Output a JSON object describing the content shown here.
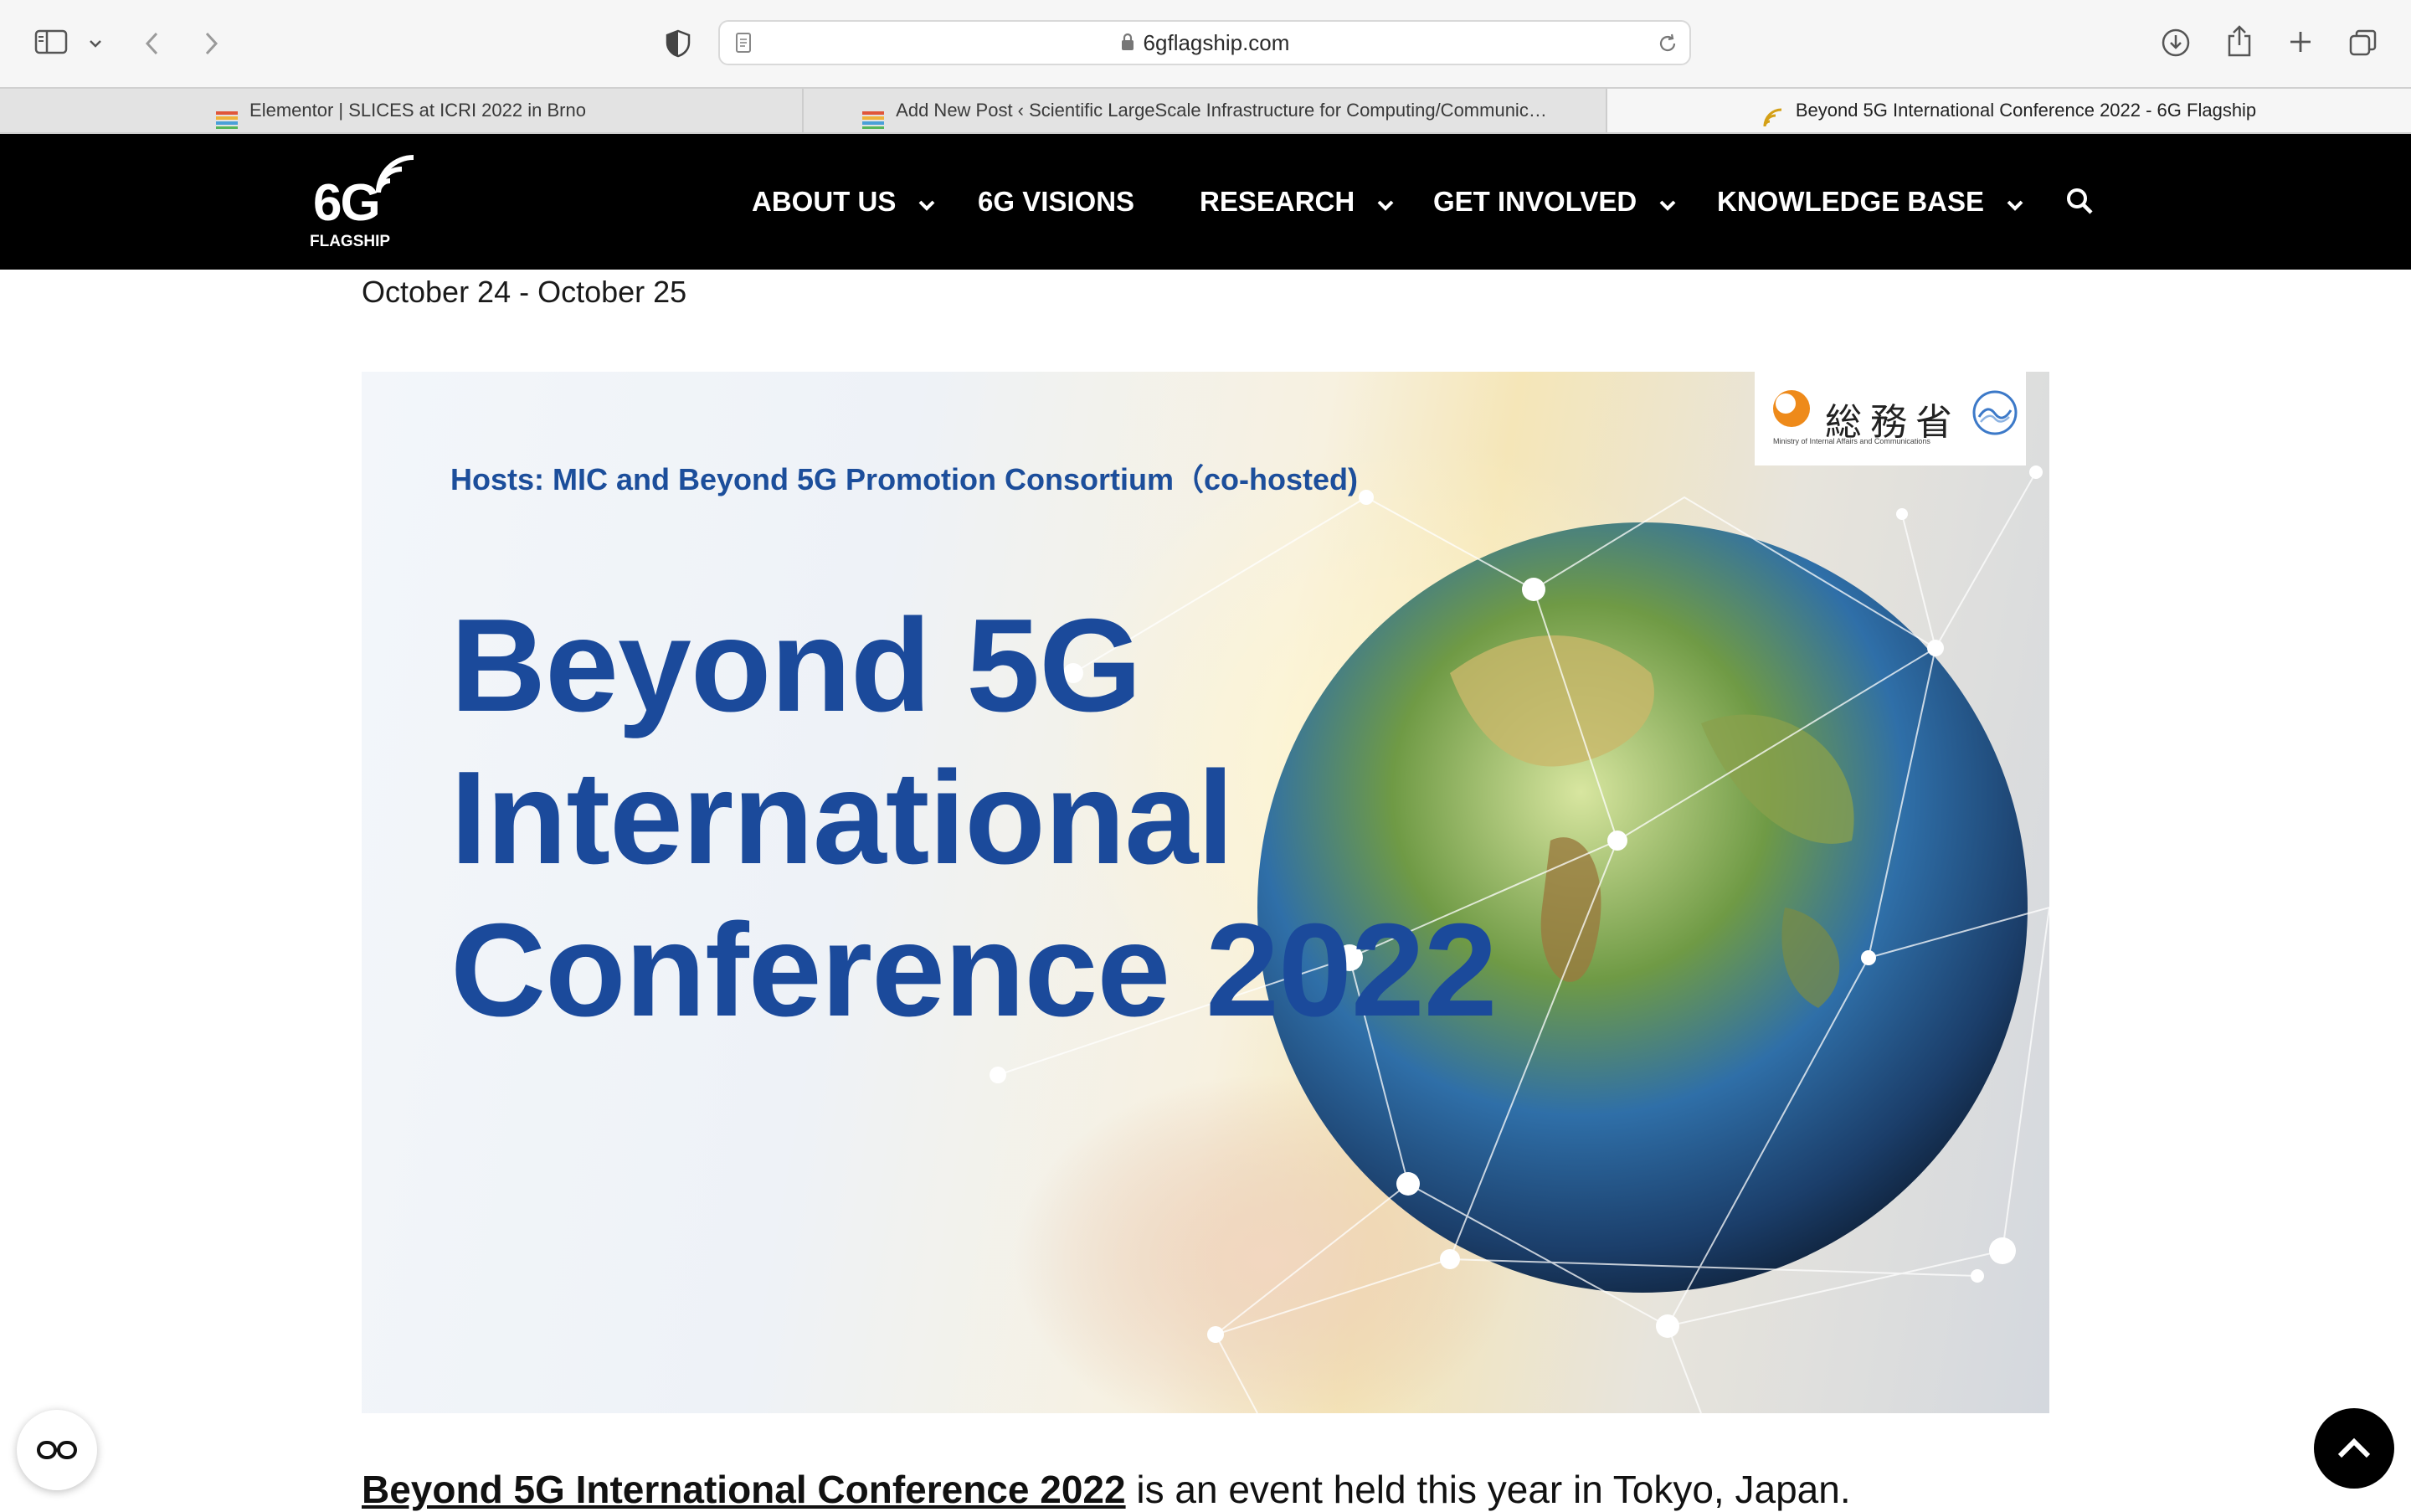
{
  "browser": {
    "url": "6gflagship.com",
    "tabs": [
      {
        "label": "Elementor | SLICES at ICRI 2022 in Brno",
        "active": false,
        "icon": "elementor-favicon"
      },
      {
        "label": "Add New Post ‹ Scientific LargeScale Infrastructure for Computing/Communic…",
        "active": false,
        "icon": "elementor-favicon"
      },
      {
        "label": "Beyond 5G International Conference 2022 - 6G Flagship",
        "active": true,
        "icon": "6g-flagship-favicon"
      }
    ]
  },
  "site": {
    "logo_main": "6G",
    "logo_sub": "FLAGSHIP",
    "nav": [
      {
        "label": "ABOUT US",
        "has_dropdown": true
      },
      {
        "label": "6G VISIONS",
        "has_dropdown": false
      },
      {
        "label": "RESEARCH",
        "has_dropdown": true
      },
      {
        "label": "GET INVOLVED",
        "has_dropdown": true
      },
      {
        "label": "KNOWLEDGE BASE",
        "has_dropdown": true
      }
    ]
  },
  "event": {
    "dates": "October 24 - October 25",
    "banner": {
      "hosts": "Hosts: MIC and Beyond 5G Promotion Consortium（co-hosted)",
      "title_line1": "Beyond 5G",
      "title_line2": "International",
      "title_line3": "Conference 2022",
      "ministry_kanji": "総務省",
      "ministry_name": "Ministry of Internal Affairs and Communications"
    },
    "intro_bold": "Beyond 5G International Conference 2022",
    "intro_rest": " is an event held this year in Tokyo, Japan."
  },
  "colors": {
    "header_bg": "#000000",
    "banner_title": "#1b4a9b",
    "banner_host": "#1c4e9b"
  }
}
